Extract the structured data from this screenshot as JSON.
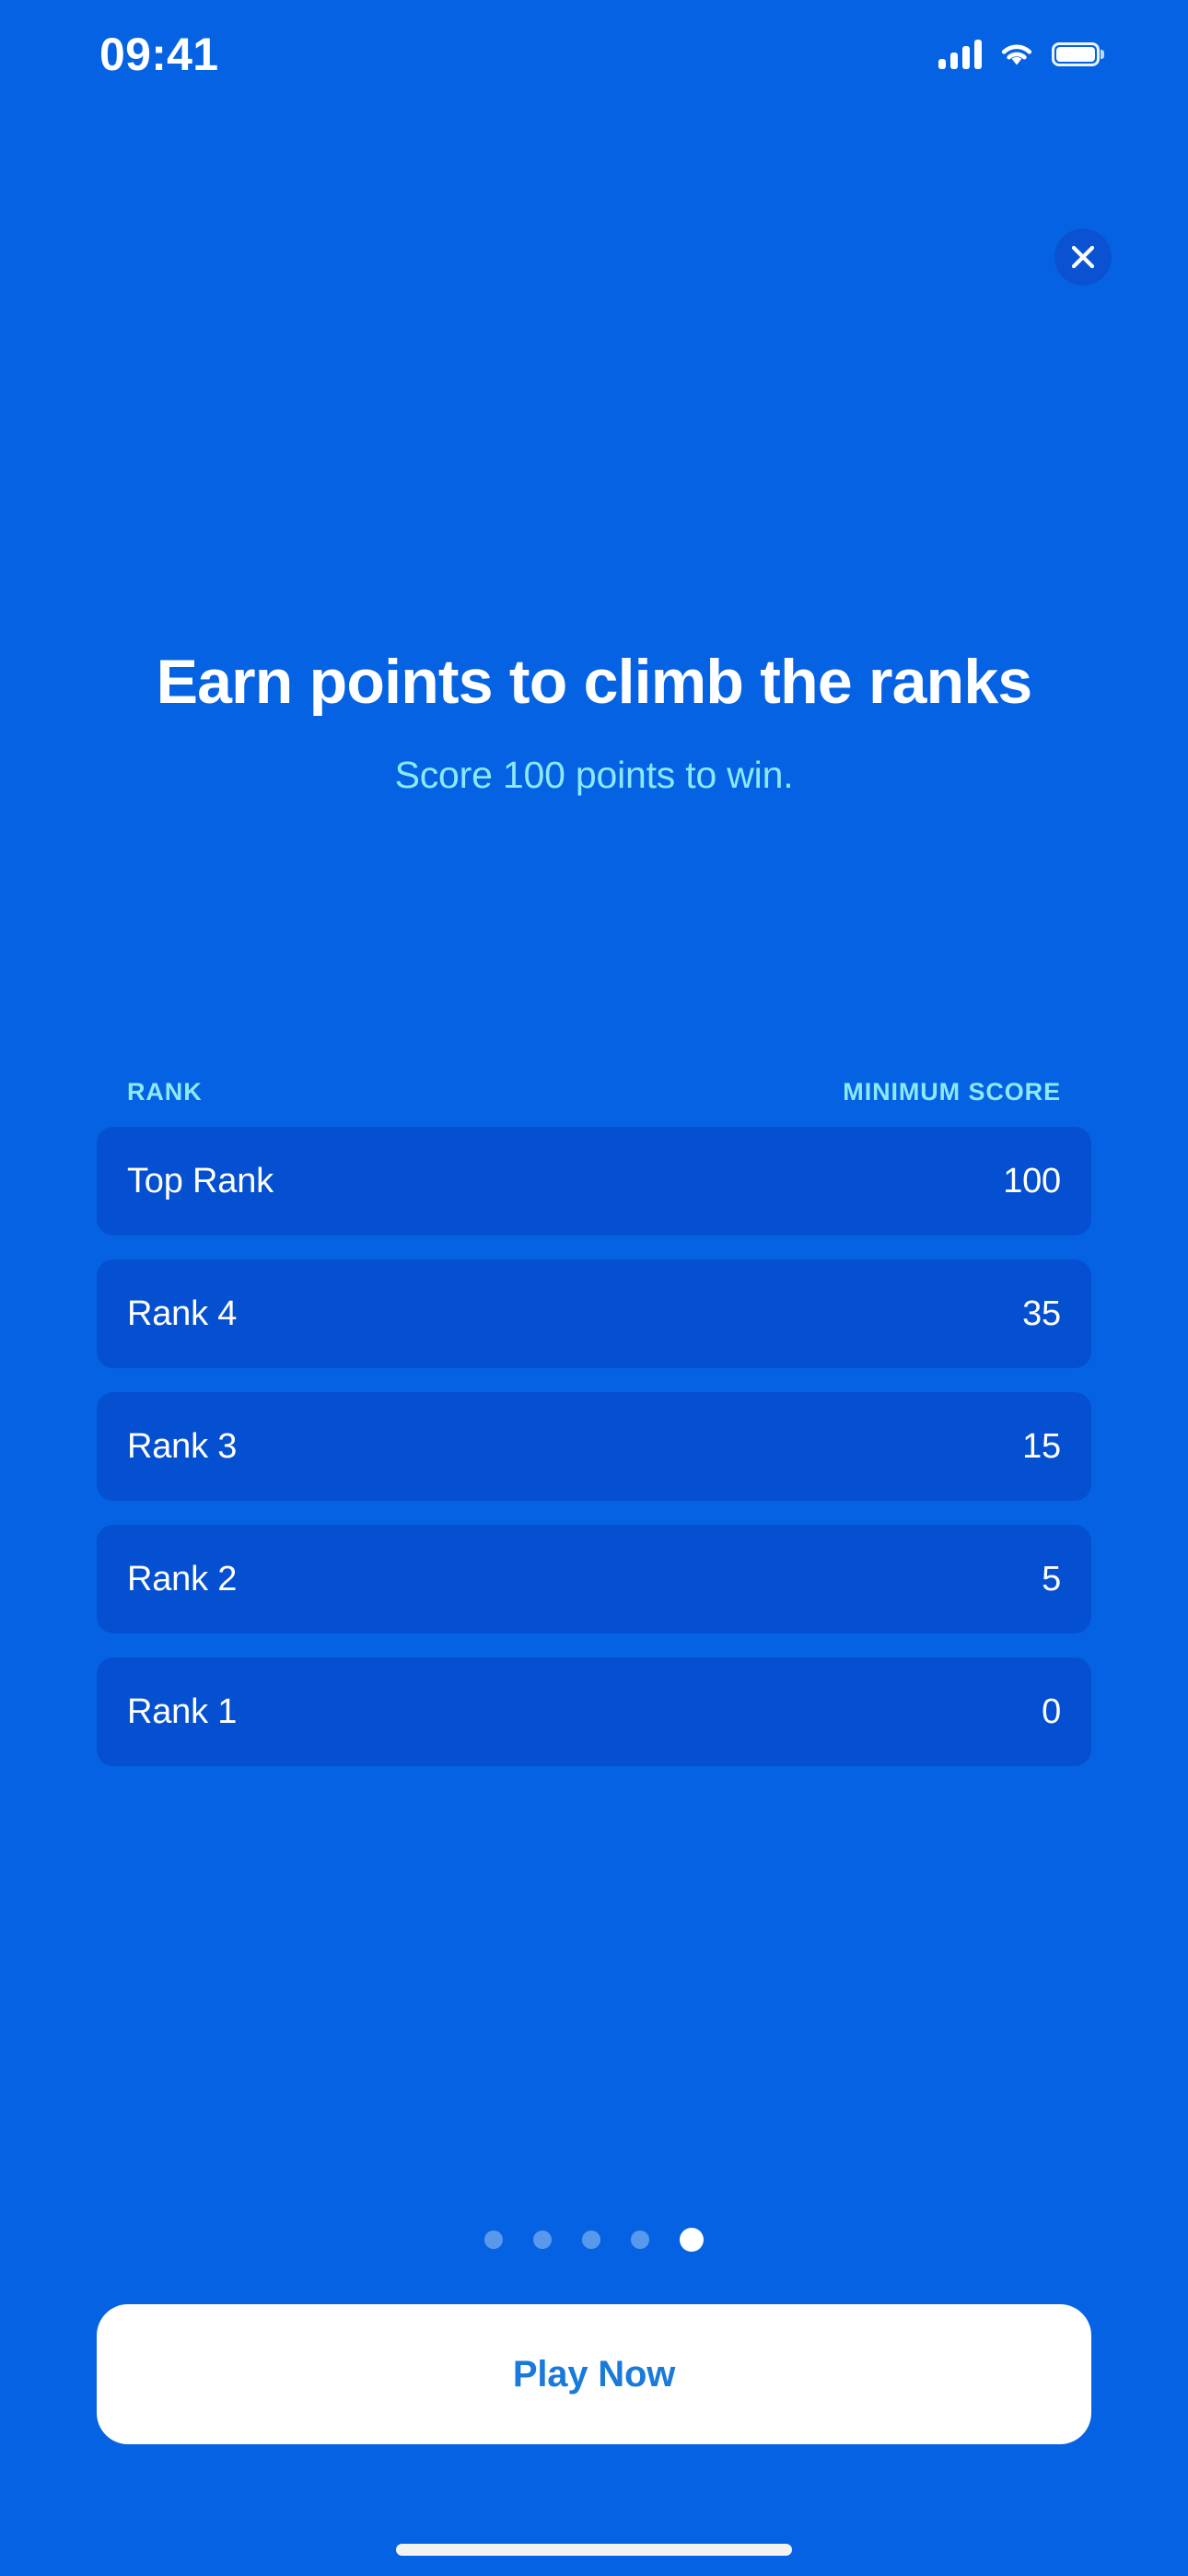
{
  "status_bar": {
    "time": "09:41",
    "cellular_icon": "cellular-signal-icon",
    "wifi_icon": "wifi-icon",
    "battery_icon": "battery-full-icon"
  },
  "header": {
    "close_icon": "close-icon"
  },
  "hero": {
    "title": "Earn points to climb the ranks",
    "subtitle": "Score 100 points to win."
  },
  "rank_table": {
    "columns": [
      "RANK",
      "MINIMUM SCORE"
    ],
    "rows": [
      {
        "rank": "Top Rank",
        "score": "100"
      },
      {
        "rank": "Rank 4",
        "score": "35"
      },
      {
        "rank": "Rank 3",
        "score": "15"
      },
      {
        "rank": "Rank 2",
        "score": "5"
      },
      {
        "rank": "Rank 1",
        "score": "0"
      }
    ]
  },
  "pagination": {
    "total": 5,
    "active_index": 4
  },
  "cta": {
    "label": "Play Now"
  },
  "colors": {
    "background": "#0563e3",
    "row_background": "#0550d0",
    "accent_cyan": "#8ce8fb",
    "cta_background": "#ffffff",
    "cta_text": "#1a7ad9",
    "close_background": "#0b52d2"
  }
}
